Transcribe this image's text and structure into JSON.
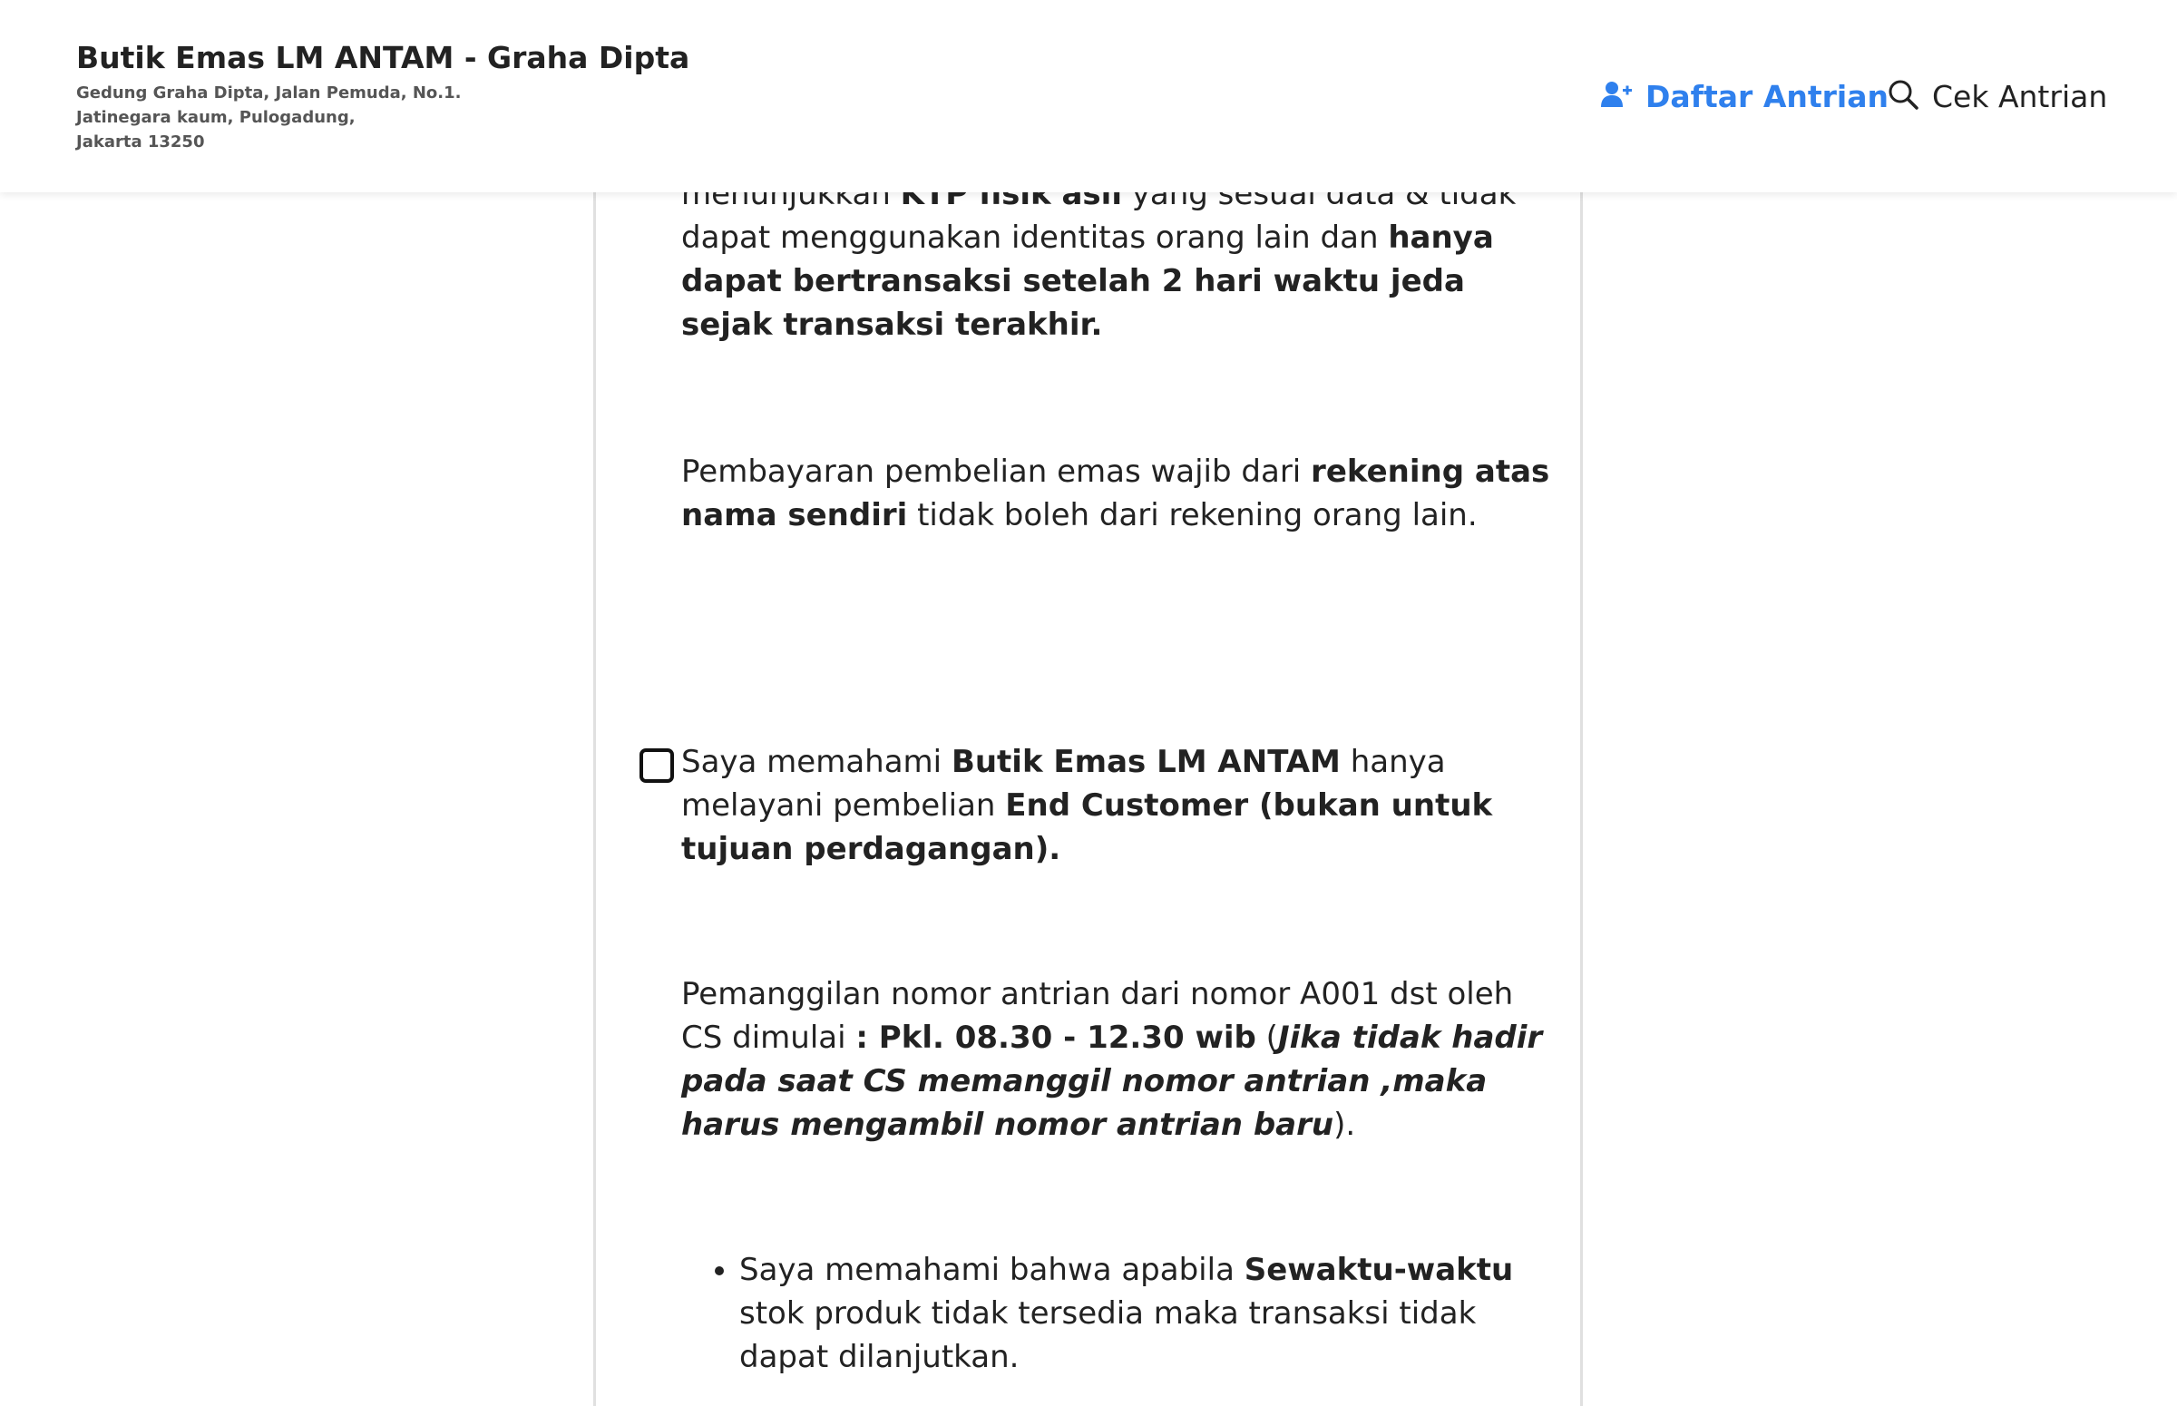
{
  "header": {
    "store_name": "Butik Emas LM ANTAM - Graha Dipta",
    "address_line1": "Gedung Graha Dipta, Jalan Pemuda, No.1.",
    "address_line2": "Jatinegara kaum, Pulogadung,",
    "address_line3": "Jakarta 13250",
    "nav": {
      "register_label": "Daftar Antrian",
      "register_icon": "user-plus-icon",
      "check_label": "Cek Antrian",
      "check_icon": "search-icon"
    }
  },
  "colors": {
    "accent": "#2f80ed",
    "text": "#222222",
    "card_border": "#e0e0e0"
  },
  "content": {
    "p1": {
      "t1": "menunjukkan ",
      "b1": "KTP fisik asli",
      "t2": " yang sesuai data & tidak dapat menggunakan identitas orang lain dan ",
      "b2": "hanya dapat bertransaksi setelah 2 hari waktu jeda sejak transaksi terakhir."
    },
    "p2": {
      "t1": "Pembayaran pembelian emas wajib dari ",
      "b1": "rekening atas nama sendiri",
      "t2": " tidak boleh dari rekening orang lain."
    },
    "agreement": {
      "checked": false,
      "t1": "Saya memahami ",
      "b1": "Butik Emas LM  ANTAM",
      "t2": " hanya melayani pembelian ",
      "b2": "End  Customer (bukan untuk tujuan perdagangan)."
    },
    "p3": {
      "t1": "Pemanggilan nomor antrian  dari nomor A001 dst oleh CS dimulai ",
      "b1": ": Pkl. 08.30 - 12.30 wib",
      "t2": " (",
      "bi1": "Jika tidak hadir pada saat CS memanggil nomor antrian ,maka harus mengambil nomor antrian baru",
      "t3": ")."
    },
    "bullet1": {
      "t1": "Saya memahami bahwa apabila ",
      "b1": "Sewaktu-waktu",
      "t2": " stok produk tidak tersedia maka transaksi tidak dapat dilanjutkan."
    }
  }
}
